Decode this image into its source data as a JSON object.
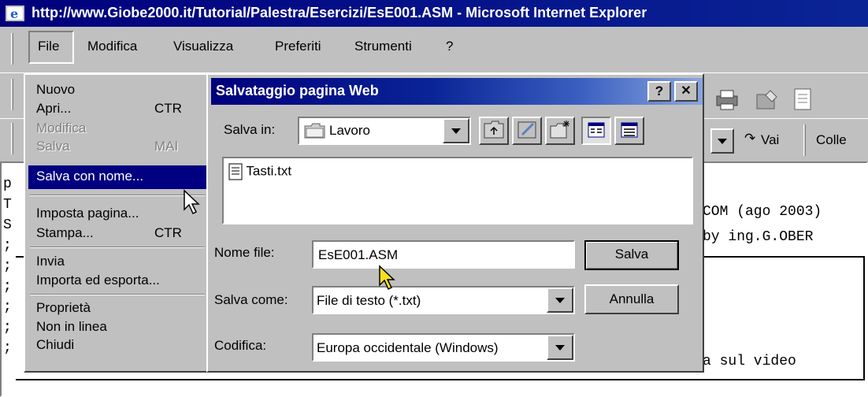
{
  "window": {
    "title": "http://www.Giobe2000.it/Tutorial/Palestra/Esercizi/EsE001.ASM - Microsoft Internet Explorer"
  },
  "menubar": [
    "File",
    "Modifica",
    "Visualizza",
    "Preferiti",
    "Strumenti",
    "?"
  ],
  "file_menu": {
    "items": [
      {
        "label": "Nuovo",
        "shortcut": ""
      },
      {
        "label": "Apri...",
        "shortcut": "CTR"
      },
      {
        "label": "Modifica",
        "shortcut": ""
      },
      {
        "label": "Salva",
        "shortcut": "MAI"
      },
      {
        "label": "Salva con nome...",
        "shortcut": ""
      },
      {
        "label": "Imposta pagina...",
        "shortcut": ""
      },
      {
        "label": "Stampa...",
        "shortcut": "CTR"
      },
      {
        "label": "Invia",
        "shortcut": ""
      },
      {
        "label": "Importa ed esporta...",
        "shortcut": ""
      },
      {
        "label": "Proprietà",
        "shortcut": ""
      },
      {
        "label": "Non in linea",
        "shortcut": ""
      },
      {
        "label": "Chiudi",
        "shortcut": ""
      }
    ]
  },
  "toolbar": {
    "go_label": "Vai",
    "links_label": "Colle"
  },
  "content": {
    "lines": [
      "p",
      "T",
      "S",
      ";",
      ";",
      ";",
      ";",
      ";",
      ";"
    ],
    "right_lines": [
      "COM (ago 2003)",
      "by ing.G.OBER",
      "a sul video"
    ]
  },
  "dialog": {
    "title": "Salvataggio pagina Web",
    "help_label": "?",
    "close_label": "✕",
    "save_in_label": "Salva in:",
    "save_in_value": "Lavoro",
    "files": [
      "Tasti.txt"
    ],
    "filename_label": "Nome file:",
    "filename_value": "EsE001.ASM",
    "save_as_label": "Salva come:",
    "save_as_value": "File di testo (*.txt)",
    "encoding_label": "Codifica:",
    "encoding_value": "Europa occidentale (Windows)",
    "save_button": "Salva",
    "cancel_button": "Annulla"
  }
}
